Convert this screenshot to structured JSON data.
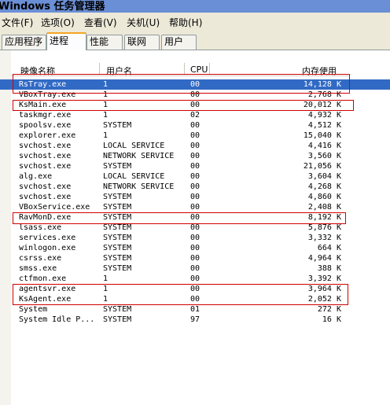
{
  "window": {
    "title": "Windows 任务管理器"
  },
  "menu": [
    {
      "label": "文件(F)"
    },
    {
      "label": "选项(O)"
    },
    {
      "label": "查看(V)"
    },
    {
      "label": "关机(U)"
    },
    {
      "label": "帮助(H)"
    }
  ],
  "tabs": [
    {
      "label": "应用程序",
      "active": false
    },
    {
      "label": "进程",
      "active": true
    },
    {
      "label": "性能",
      "active": false
    },
    {
      "label": "联网",
      "active": false
    },
    {
      "label": "用户",
      "active": false
    }
  ],
  "table": {
    "columns": [
      "映像名称",
      "用户名",
      "CPU",
      "内存使用"
    ],
    "rows": [
      {
        "name": "RsTray.exe",
        "user": "1",
        "cpu": "00",
        "mem": "14,128 K",
        "selected": true
      },
      {
        "name": "VBoxTray.exe",
        "user": "1",
        "cpu": "00",
        "mem": "2,768 K"
      },
      {
        "name": "KsMain.exe",
        "user": "1",
        "cpu": "00",
        "mem": "20,012 K"
      },
      {
        "name": "taskmgr.exe",
        "user": "1",
        "cpu": "02",
        "mem": "4,932 K"
      },
      {
        "name": "spoolsv.exe",
        "user": "SYSTEM",
        "cpu": "00",
        "mem": "4,512 K"
      },
      {
        "name": "explorer.exe",
        "user": "1",
        "cpu": "00",
        "mem": "15,040 K"
      },
      {
        "name": "svchost.exe",
        "user": "LOCAL SERVICE",
        "cpu": "00",
        "mem": "4,416 K"
      },
      {
        "name": "svchost.exe",
        "user": "NETWORK SERVICE",
        "cpu": "00",
        "mem": "3,560 K"
      },
      {
        "name": "svchost.exe",
        "user": "SYSTEM",
        "cpu": "00",
        "mem": "21,056 K"
      },
      {
        "name": "alg.exe",
        "user": "LOCAL SERVICE",
        "cpu": "00",
        "mem": "3,604 K"
      },
      {
        "name": "svchost.exe",
        "user": "NETWORK SERVICE",
        "cpu": "00",
        "mem": "4,268 K"
      },
      {
        "name": "svchost.exe",
        "user": "SYSTEM",
        "cpu": "00",
        "mem": "4,860 K"
      },
      {
        "name": "VBoxService.exe",
        "user": "SYSTEM",
        "cpu": "00",
        "mem": "2,408 K"
      },
      {
        "name": "RavMonD.exe",
        "user": "SYSTEM",
        "cpu": "00",
        "mem": "8,192 K"
      },
      {
        "name": "lsass.exe",
        "user": "SYSTEM",
        "cpu": "00",
        "mem": "5,876 K"
      },
      {
        "name": "services.exe",
        "user": "SYSTEM",
        "cpu": "00",
        "mem": "3,332 K"
      },
      {
        "name": "winlogon.exe",
        "user": "SYSTEM",
        "cpu": "00",
        "mem": "664 K"
      },
      {
        "name": "csrss.exe",
        "user": "SYSTEM",
        "cpu": "00",
        "mem": "4,964 K"
      },
      {
        "name": "smss.exe",
        "user": "SYSTEM",
        "cpu": "00",
        "mem": "388 K"
      },
      {
        "name": "ctfmon.exe",
        "user": "1",
        "cpu": "00",
        "mem": "3,392 K"
      },
      {
        "name": "agentsvr.exe",
        "user": "1",
        "cpu": "00",
        "mem": "3,964 K"
      },
      {
        "name": "KsAgent.exe",
        "user": "1",
        "cpu": "00",
        "mem": "2,052 K"
      },
      {
        "name": "System",
        "user": "SYSTEM",
        "cpu": "01",
        "mem": "272 K"
      },
      {
        "name": "System Idle P...",
        "user": "SYSTEM",
        "cpu": "97",
        "mem": "16 K"
      }
    ]
  },
  "colors": {
    "selection": "#316ac5",
    "annotation": "#d00000",
    "title_bar": "#6b8fd6",
    "chrome": "#ece9d8"
  }
}
